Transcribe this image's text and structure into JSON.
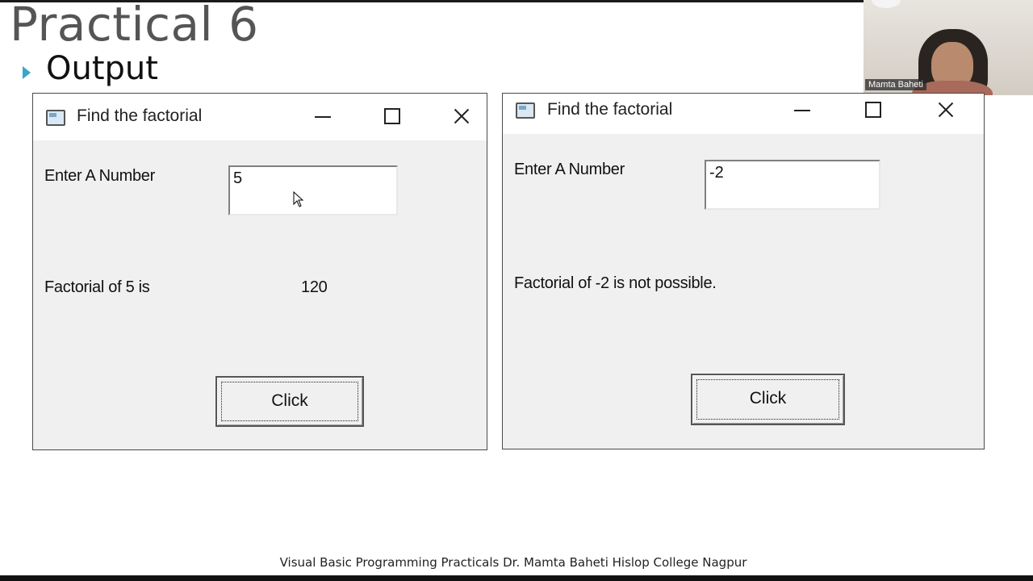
{
  "slide": {
    "title": "Practical 6",
    "subtitle": "Output",
    "footer": "Visual Basic Programming Practicals Dr. Mamta Baheti Hislop College Nagpur"
  },
  "video": {
    "participant_name": "Mamta Baheti"
  },
  "window_left": {
    "title": "Find the factorial",
    "input_label": "Enter A Number",
    "input_value": "5",
    "result_label": "Factorial of 5 is",
    "result_value": "120",
    "button_label": "Click"
  },
  "window_right": {
    "title": "Find the factorial",
    "input_label": "Enter A Number",
    "input_value": "-2",
    "result_label": "Factorial of -2 is not possible.",
    "button_label": "Click"
  },
  "icons": {
    "window_icon": "form-icon",
    "minimize": "minimize-icon",
    "maximize": "maximize-icon",
    "close": "close-icon",
    "bullet": "triangle-bullet-icon",
    "cursor": "mouse-pointer-icon"
  },
  "colors": {
    "bullet_accent": "#3aa6c9",
    "window_body": "#f0f0f0",
    "title_grey": "#555555"
  }
}
